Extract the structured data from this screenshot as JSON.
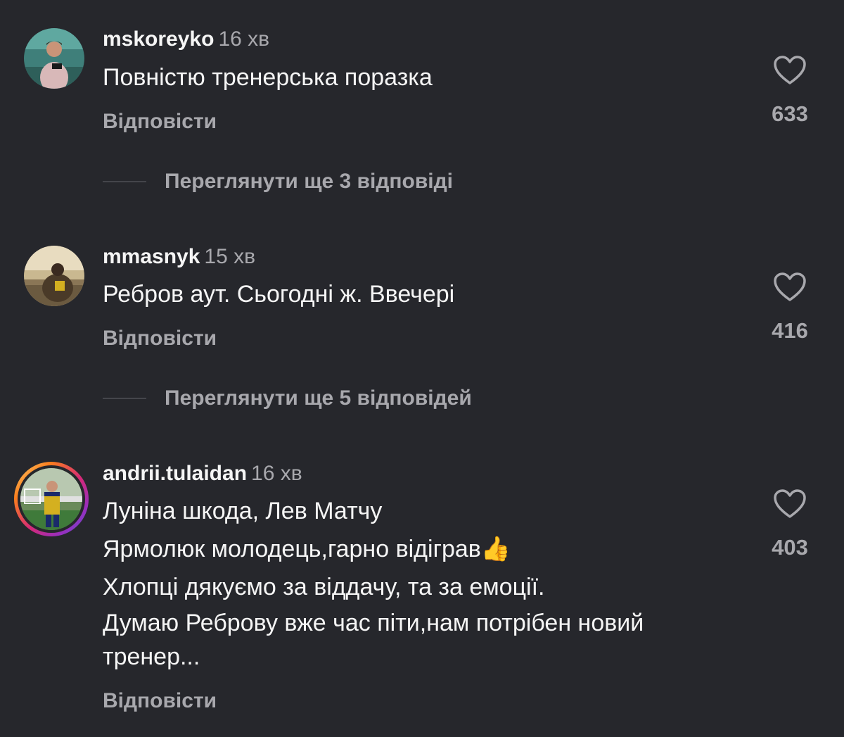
{
  "comments": [
    {
      "username": "mskoreyko",
      "time": "16 хв",
      "lines": [
        "Повністю тренерська поразка"
      ],
      "reply_label": "Відповісти",
      "likes": "633",
      "view_more": "Переглянути ще 3 відповіді"
    },
    {
      "username": "mmasnyk",
      "time": "15 хв",
      "lines": [
        "Ребров аут. Сьогодні ж. Ввечері"
      ],
      "reply_label": "Відповісти",
      "likes": "416",
      "view_more": "Переглянути ще 5 відповідей"
    },
    {
      "username": "andrii.tulaidan",
      "time": "16 хв",
      "lines": [
        "Луніна шкода, Лев Матчу",
        "Ярмолюк молодець,гарно відіграв",
        "Хлопці дякуємо за віддачу, та за емоції.",
        "Думаю Реброву вже час піти,нам потрібен новий тренер..."
      ],
      "reply_label": "Відповісти",
      "likes": "403"
    }
  ],
  "icons": {
    "like": "heart-outline-icon",
    "emoji": "thumbs-up-emoji"
  },
  "colors": {
    "background": "#26272c",
    "primary_text": "#f5f5f5",
    "secondary_text": "#a8a8ad"
  }
}
